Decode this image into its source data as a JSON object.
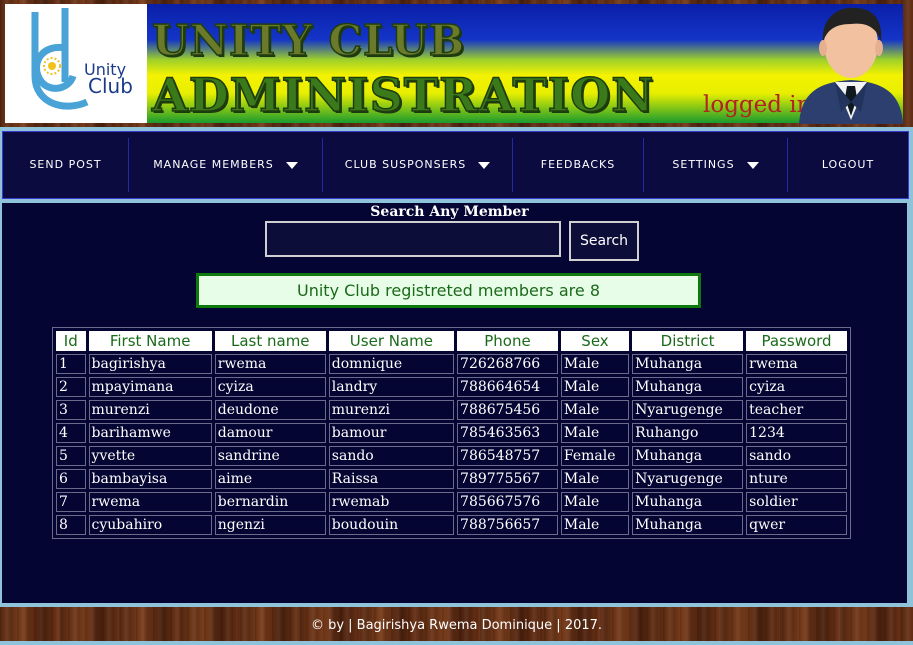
{
  "header": {
    "logo_line1": "Unity",
    "logo_line2": "Club",
    "title_line1": "Unity Club",
    "title_line2": "Administration",
    "status": "logged in"
  },
  "nav": {
    "items": [
      {
        "label": "Send Post",
        "dropdown": false
      },
      {
        "label": "Manage Members",
        "dropdown": true
      },
      {
        "label": "Club Susponsers",
        "dropdown": true
      },
      {
        "label": "Feedbacks",
        "dropdown": false
      },
      {
        "label": "Settings",
        "dropdown": true
      },
      {
        "label": "Logout",
        "dropdown": false
      }
    ]
  },
  "search": {
    "label": "Search Any Member",
    "value": "",
    "button": "Search"
  },
  "count_message": "Unity Club registreted members are 8",
  "table": {
    "headers": [
      "Id",
      "First Name",
      "Last name",
      "User Name",
      "Phone",
      "Sex",
      "District",
      "Password"
    ],
    "rows": [
      [
        "1",
        "bagirishya",
        "rwema",
        "domnique",
        "726268766",
        "Male",
        "Muhanga",
        "rwema"
      ],
      [
        "2",
        "mpayimana",
        "cyiza",
        "landry",
        "788664654",
        "Male",
        "Muhanga",
        "cyiza"
      ],
      [
        "3",
        "murenzi",
        "deudone",
        "murenzi",
        "788675456",
        "Male",
        "Nyarugenge",
        "teacher"
      ],
      [
        "4",
        "barihamwe",
        "damour",
        "bamour",
        "785463563",
        "Male",
        "Ruhango",
        "1234"
      ],
      [
        "5",
        "yvette",
        "sandrine",
        "sando",
        "786548757",
        "Female",
        "Muhanga",
        "sando"
      ],
      [
        "6",
        "bambayisa",
        "aime",
        "Raissa",
        "789775567",
        "Male",
        "Nyarugenge",
        "nture"
      ],
      [
        "7",
        "rwema",
        "bernardin",
        "rwemab",
        "785667576",
        "Male",
        "Muhanga",
        "soldier"
      ],
      [
        "8",
        "cyubahiro",
        "ngenzi",
        "boudouin",
        "788756657",
        "Male",
        "Muhanga",
        "qwer"
      ]
    ]
  },
  "footer": "© by | Bagirishya Rwema Dominique | 2017.",
  "colors": {
    "nav_bg": "#0b0b40",
    "main_bg": "#050533",
    "accent_green": "#0c7a0c",
    "header_text_green": "#1a6a1a",
    "logged_in_red": "#b22222"
  }
}
